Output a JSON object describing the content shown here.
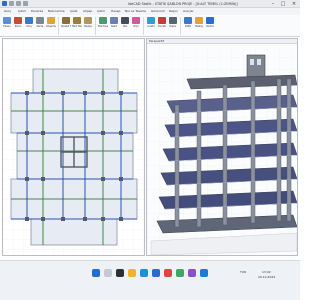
{
  "app": {
    "title": "IdeCAD Statik - STATİK ŞABLON PROJE - [0:ALT TEMEL (1:ZEMİN)]",
    "window_controls": [
      "–",
      "□",
      "×"
    ]
  },
  "ribbon": {
    "tabs": [
      "Giriş",
      "Çizim",
      "Düzenle",
      "Betonarme",
      "Çelik",
      "Ahşap",
      "Çizim",
      "Hesap",
      "Bul ve Tasarla",
      "Görünüm",
      "Rapor",
      "Araçlar"
    ],
    "groups": [
      {
        "buttons": [
          "Eksen",
          "Kolon",
          "Kiriş",
          "Perde",
          "Döşeme"
        ]
      },
      {
        "buttons": [
          "Sürekli Temel",
          "Tekil Temel",
          "Radye"
        ]
      },
      {
        "buttons": [
          "Merdiven",
          "Kesit",
          "Yazı",
          "Ölçü"
        ]
      },
      {
        "buttons": [
          "Analiz",
          "Donatı",
          "Rapor"
        ]
      },
      {
        "buttons": [
          "Pafta",
          "Metraj",
          "Yardım"
        ]
      }
    ]
  },
  "panels": {
    "plan": {
      "title": ""
    },
    "perspective": {
      "title": "Perspektif"
    }
  },
  "taskbar": {
    "time": "13:02",
    "date": "20.10.2024",
    "lang": "TUR"
  },
  "colors": {
    "titlebar": "#e9ebee",
    "accent": "#1f6fd1",
    "beam_blue": "#2b4fb0",
    "beam_green": "#3f8a3f",
    "slab_fill": "#e7ecf4",
    "wall_gray": "#555b66"
  }
}
